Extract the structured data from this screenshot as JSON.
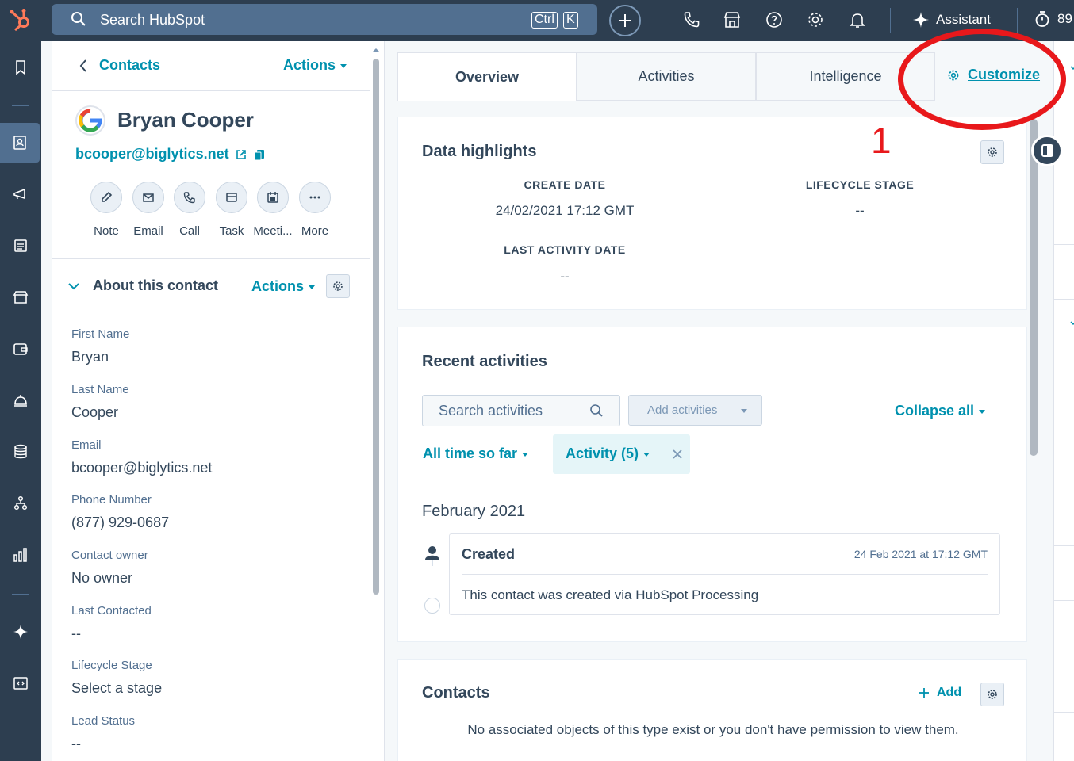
{
  "topbar": {
    "search_placeholder": "Search HubSpot",
    "kbd_ctrl": "Ctrl",
    "kbd_k": "K",
    "assistant_label": "Assistant",
    "timer_value": "89"
  },
  "left_panel": {
    "breadcrumb": "Contacts",
    "actions_label": "Actions",
    "contact_name": "Bryan Cooper",
    "contact_email": "bcooper@biglytics.net",
    "action_buttons": [
      {
        "label": "Note",
        "icon": "edit-icon"
      },
      {
        "label": "Email",
        "icon": "envelope-icon"
      },
      {
        "label": "Call",
        "icon": "phone-icon"
      },
      {
        "label": "Task",
        "icon": "task-icon"
      },
      {
        "label": "Meeti...",
        "icon": "calendar-icon"
      },
      {
        "label": "More",
        "icon": "more-icon"
      }
    ],
    "about_title": "About this contact",
    "about_actions": "Actions",
    "properties": [
      {
        "label": "First Name",
        "value": "Bryan"
      },
      {
        "label": "Last Name",
        "value": "Cooper"
      },
      {
        "label": "Email",
        "value": "bcooper@biglytics.net"
      },
      {
        "label": "Phone Number",
        "value": "(877) 929-0687"
      },
      {
        "label": "Contact owner",
        "value": "No owner"
      },
      {
        "label": "Last Contacted",
        "value": "--"
      },
      {
        "label": "Lifecycle Stage",
        "value": "Select a stage"
      },
      {
        "label": "Lead Status",
        "value": "--"
      }
    ]
  },
  "tabs": [
    {
      "label": "Overview",
      "active": true
    },
    {
      "label": "Activities",
      "active": false
    },
    {
      "label": "Intelligence",
      "active": false
    }
  ],
  "customize_label": "Customize",
  "data_highlights": {
    "title": "Data highlights",
    "create_date_label": "CREATE DATE",
    "create_date_value": "24/02/2021 17:12 GMT",
    "lifecycle_label": "LIFECYCLE STAGE",
    "lifecycle_value": "--",
    "last_activity_label": "LAST ACTIVITY DATE",
    "last_activity_value": "--"
  },
  "recent_activities": {
    "title": "Recent activities",
    "search_placeholder": "Search activities",
    "add_activities": "Add activities",
    "collapse_all": "Collapse all",
    "time_filter": "All time so far",
    "activity_filter": "Activity (5)",
    "month": "February 2021",
    "item_title": "Created",
    "item_time": "24 Feb 2021 at 17:12 GMT",
    "item_body": "This contact was created via HubSpot Processing"
  },
  "contacts_card": {
    "title": "Contacts",
    "add_label": "Add",
    "empty_text": "No associated objects of this type exist or you don't have permission to view them."
  },
  "annotation": {
    "number": "1",
    "color": "#e8181b"
  },
  "colors": {
    "nav_bg": "#2d3e50",
    "link": "#0091ae",
    "text": "#33475b"
  }
}
